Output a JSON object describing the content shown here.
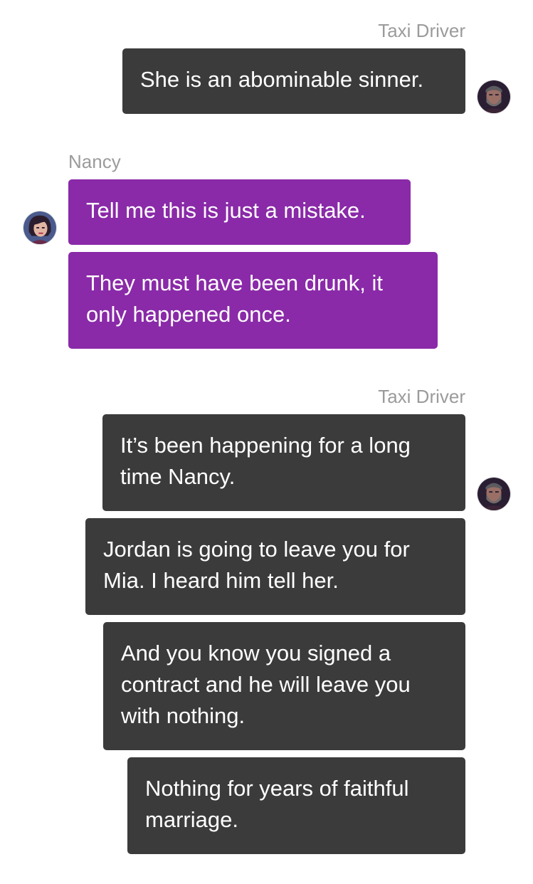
{
  "conversation": {
    "group1": {
      "sender": "Taxi Driver",
      "messages": [
        "She is an abominable sinner."
      ]
    },
    "group2": {
      "sender": "Nancy",
      "messages": [
        "Tell me this is just a mistake.",
        "They must have been drunk, it only happened once."
      ]
    },
    "group3": {
      "sender": "Taxi Driver",
      "messages": [
        "It’s been happening for a long time Nancy.",
        "Jordan is going to leave you for Mia. I heard him tell her.",
        "And you know you signed a contract and he will leave you with nothing.",
        "Nothing for years of faithful marriage."
      ]
    }
  },
  "colors": {
    "outgoing_bubble": "#3b3b3b",
    "incoming_bubble": "#8a2aa8",
    "sender_label": "#9b9b9b",
    "background": "#ffffff"
  },
  "icons": {
    "taxi_driver_avatar": "bearded-man-portrait",
    "nancy_avatar": "woman-portrait"
  }
}
